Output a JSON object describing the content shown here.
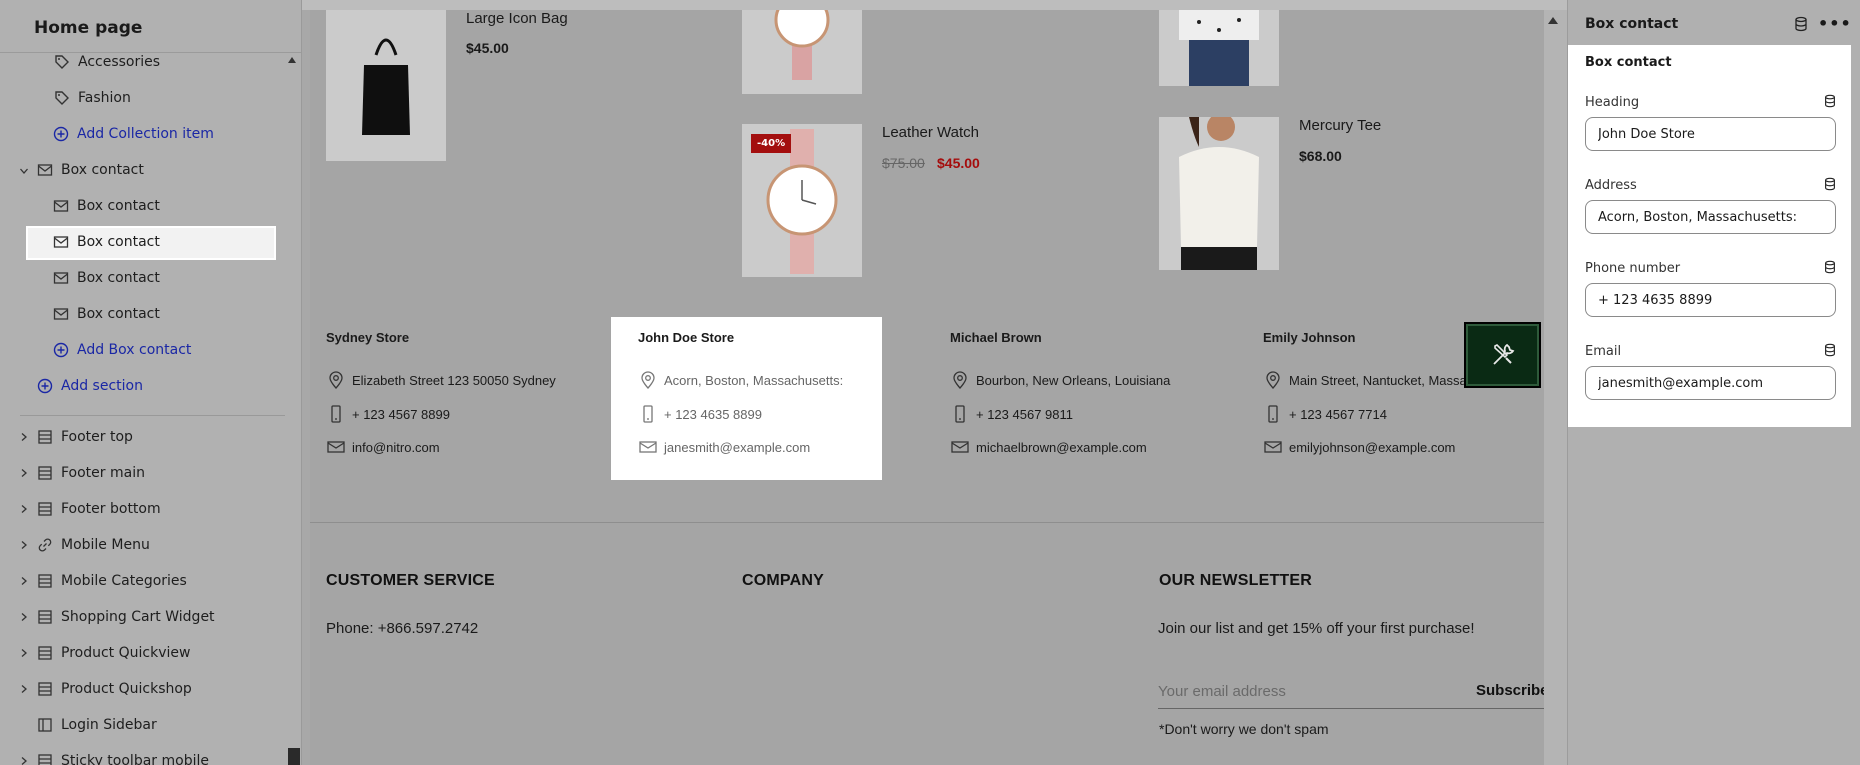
{
  "sidebar": {
    "title": "Home page",
    "items": [
      {
        "label": "Accessories",
        "icon": "tag-icon"
      },
      {
        "label": "Fashion",
        "icon": "tag-icon"
      },
      {
        "label": "Add Collection item",
        "icon": "plus-circle-icon"
      },
      {
        "label": "Box contact",
        "icon": "mail-icon"
      },
      {
        "label": "Box contact",
        "icon": "mail-icon"
      },
      {
        "label": "Box contact",
        "icon": "mail-icon"
      },
      {
        "label": "Box contact",
        "icon": "mail-icon"
      },
      {
        "label": "Box contact",
        "icon": "mail-icon"
      },
      {
        "label": "Add Box contact",
        "icon": "plus-circle-icon"
      },
      {
        "label": "Add section",
        "icon": "plus-circle-icon"
      },
      {
        "label": "Footer top",
        "icon": "layout-icon"
      },
      {
        "label": "Footer main",
        "icon": "layout-icon"
      },
      {
        "label": "Footer bottom",
        "icon": "layout-icon"
      },
      {
        "label": "Mobile Menu",
        "icon": "link-icon"
      },
      {
        "label": "Mobile Categories",
        "icon": "layout-icon"
      },
      {
        "label": "Shopping Cart Widget",
        "icon": "layout-icon"
      },
      {
        "label": "Product Quickview",
        "icon": "layout-icon"
      },
      {
        "label": "Product Quickshop",
        "icon": "layout-icon"
      },
      {
        "label": "Login Sidebar",
        "icon": "sidebar-icon"
      },
      {
        "label": "Sticky toolbar mobile",
        "icon": "layout-icon"
      }
    ]
  },
  "products": [
    {
      "name": "Large Icon Bag",
      "price": "$45.00"
    },
    {
      "name": "Leather Watch",
      "old_price": "$75.00",
      "price": "$45.00",
      "badge": "-40%"
    },
    {
      "name": "Mercury Tee",
      "price": "$68.00"
    }
  ],
  "stores": [
    {
      "name": "Sydney Store",
      "address": "Elizabeth Street 123 50050 Sydney",
      "phone": "+ 123 4567 8899",
      "email": "info@nitro.com"
    },
    {
      "name": "John Doe Store",
      "address": "Acorn, Boston, Massachusetts:",
      "phone": "+ 123 4635 8899",
      "email": "janesmith@example.com"
    },
    {
      "name": "Michael Brown",
      "address": "Bourbon, New Orleans, Louisiana",
      "phone": "+ 123 4567 9811",
      "email": "michaelbrown@example.com"
    },
    {
      "name": "Emily Johnson",
      "address": "Main Street, Nantucket, Massach",
      "phone": "+ 123 4567 7714",
      "email": "emilyjohnson@example.com"
    }
  ],
  "footer": {
    "customer_service": {
      "heading": "CUSTOMER SERVICE",
      "phone": "Phone: +866.597.2742"
    },
    "company": {
      "heading": "COMPANY"
    },
    "newsletter": {
      "heading": "OUR NEWSLETTER",
      "text": "Join our list and get 15% off your first purchase!",
      "placeholder": "Your email address",
      "subscribe": "Subscribe",
      "note": "*Don't worry we don't spam"
    }
  },
  "panel": {
    "title": "Box contact",
    "more": "•••",
    "card_title": "Box contact",
    "fields": {
      "heading": {
        "label": "Heading",
        "value": "John Doe Store"
      },
      "address": {
        "label": "Address",
        "value": "Acorn, Boston, Massachusetts:"
      },
      "phone": {
        "label": "Phone number",
        "value": "+ 123 4635 8899"
      },
      "email": {
        "label": "Email",
        "value": "janesmith@example.com"
      }
    }
  },
  "colors": {
    "sale": "#a50d0d",
    "link": "#1a27a5",
    "fab": "#0a2a14"
  }
}
